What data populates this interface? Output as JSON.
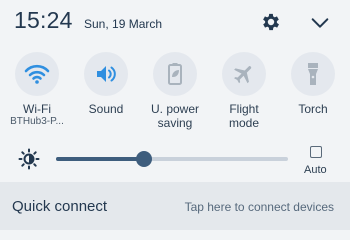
{
  "status": {
    "time": "15:24",
    "date": "Sun, 19 March"
  },
  "header": {
    "settings_icon": "gear-icon",
    "expand_icon": "chevron-down-icon"
  },
  "tiles": [
    {
      "label": "Wi-Fi",
      "sublabel": "BTHub3-P...",
      "icon": "wifi-icon",
      "active": true
    },
    {
      "label": "Sound",
      "sublabel": "",
      "icon": "speaker-icon",
      "active": true
    },
    {
      "label": "U. power saving",
      "label_line1": "U. power",
      "label_line2": "saving",
      "icon": "power-saving-icon",
      "active": false
    },
    {
      "label": "Flight mode",
      "label_line1": "Flight",
      "label_line2": "mode",
      "icon": "airplane-icon",
      "active": false
    },
    {
      "label": "Torch",
      "sublabel": "",
      "icon": "torch-icon",
      "active": false
    }
  ],
  "brightness": {
    "icon": "brightness-icon",
    "level_fraction": 0.38,
    "auto_label": "Auto",
    "auto_checked": false
  },
  "quick_connect": {
    "title": "Quick connect",
    "hint": "Tap here to connect devices"
  },
  "colors": {
    "active_icon": "#2f8fe0",
    "inactive_icon": "#a9b3bd",
    "slider": "#3e5d7d",
    "text_dark": "#23384f"
  }
}
